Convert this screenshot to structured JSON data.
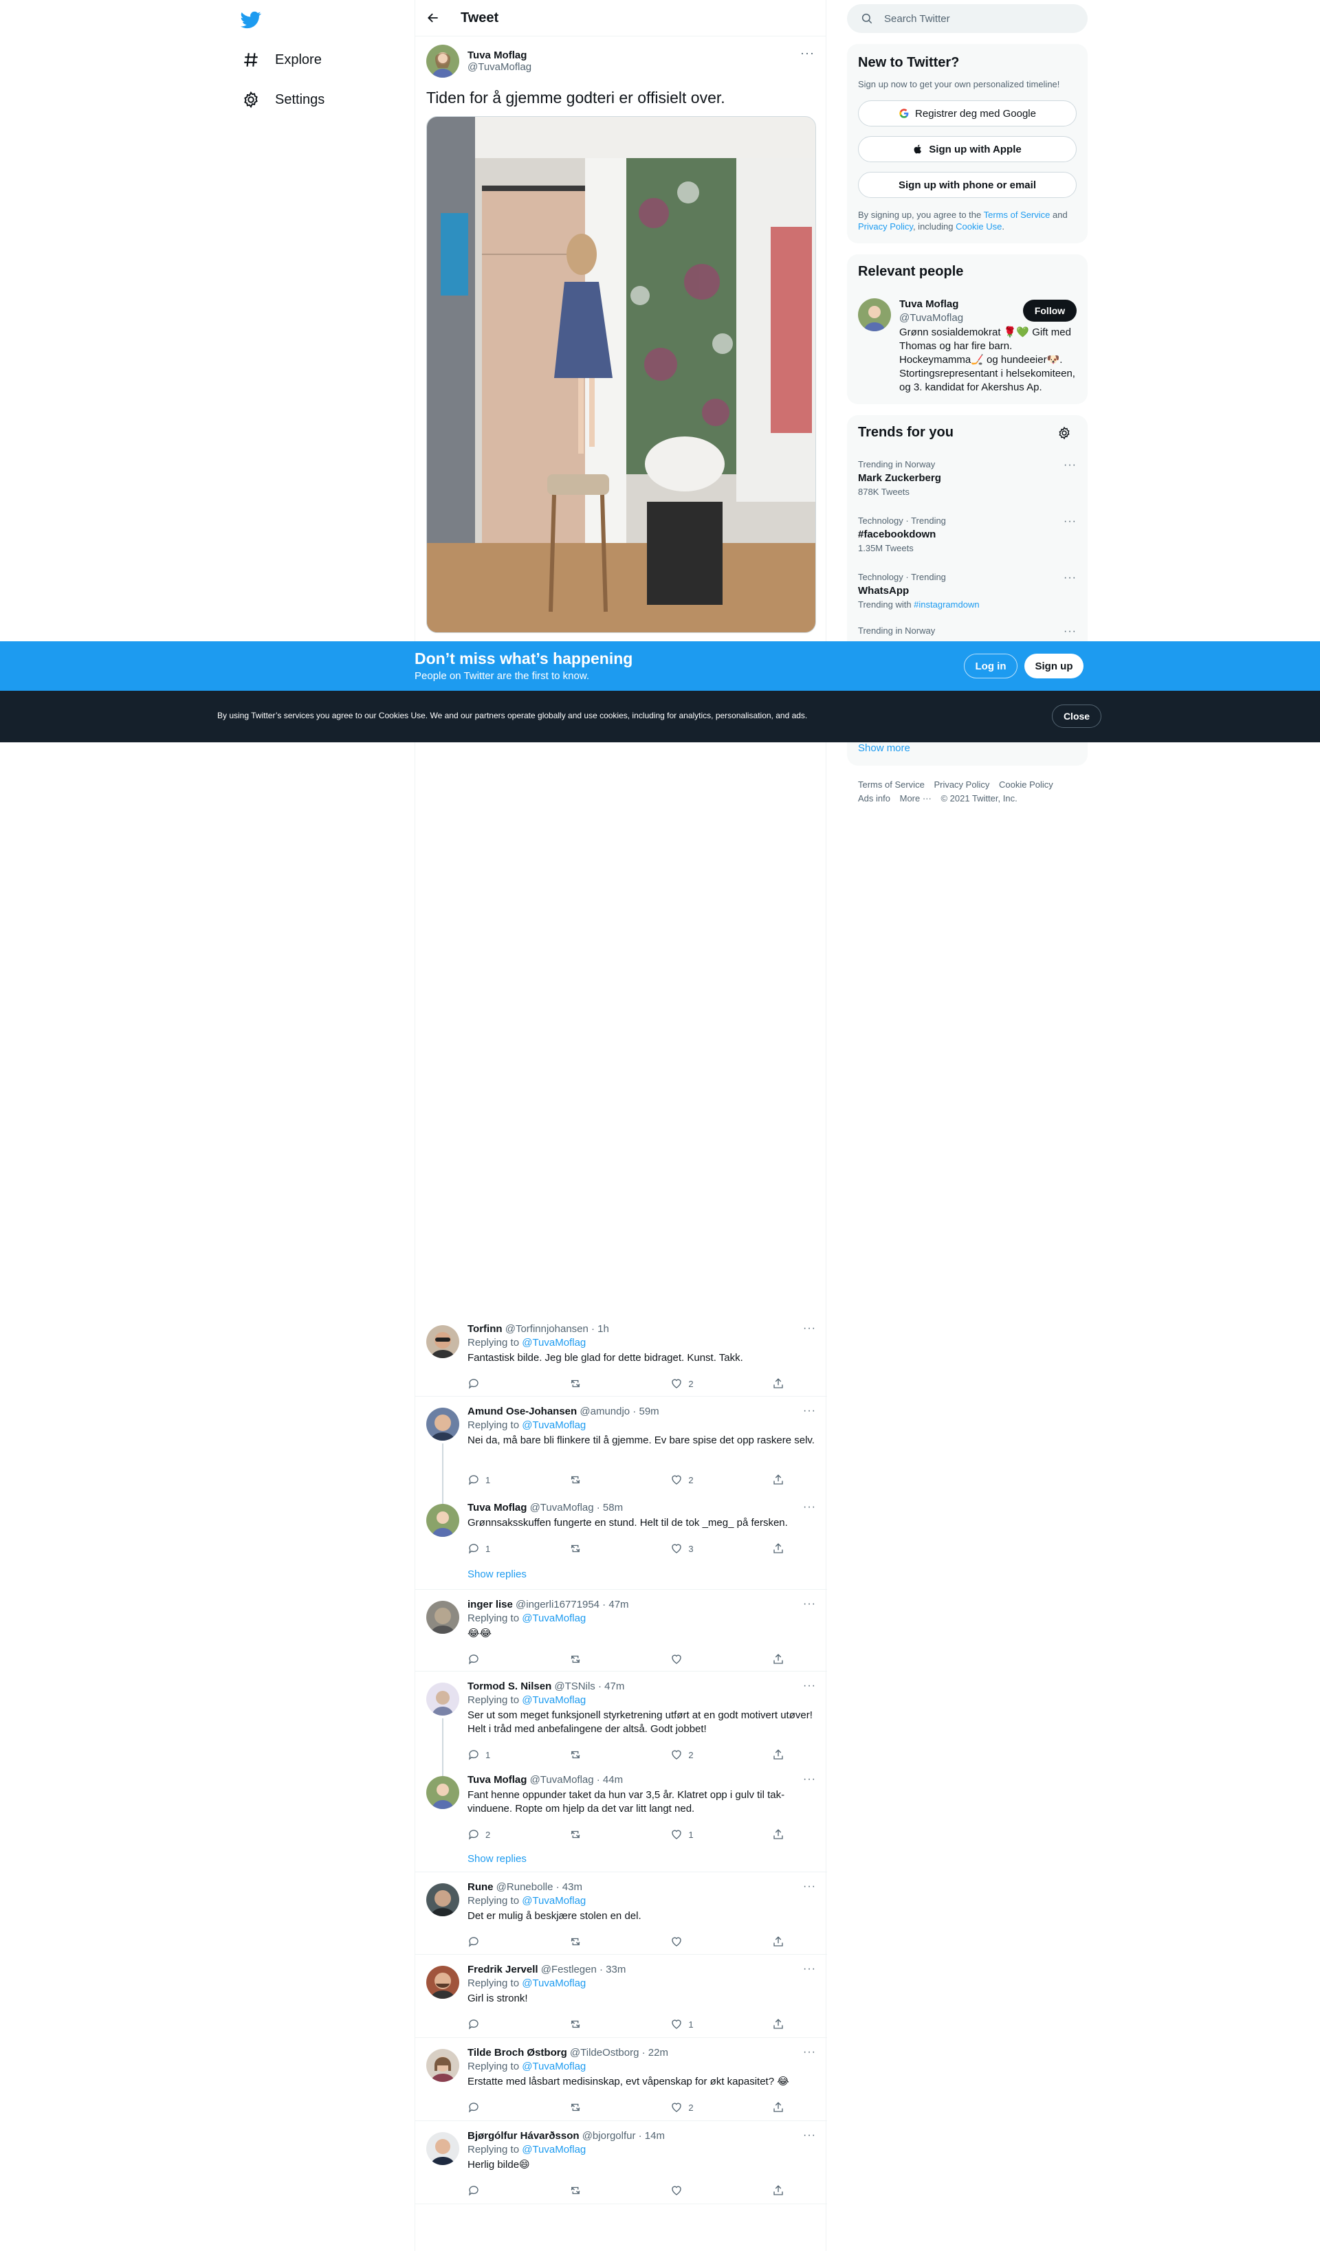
{
  "nav": {
    "explore": "Explore",
    "settings": "Settings"
  },
  "header": {
    "title": "Tweet"
  },
  "main_tweet": {
    "name": "Tuva Moflag",
    "handle": "@TuvaMoflag",
    "text": "Tiden for å gjemme godteri er offisielt over."
  },
  "banner": {
    "title": "Don’t miss what’s happening",
    "subtitle": "People on Twitter are the first to know.",
    "login": "Log in",
    "signup": "Sign up"
  },
  "cookie": {
    "text": "By using Twitter’s services you agree to our Cookies Use. We and our partners operate globally and use cookies, including for analytics, personalisation, and ads.",
    "close": "Close"
  },
  "search": {
    "placeholder": "Search Twitter"
  },
  "new_to_twitter": {
    "title": "New to Twitter?",
    "subtitle": "Sign up now to get your own personalized timeline!",
    "google": "Registrer deg med Google",
    "apple": "Sign up with Apple",
    "phone": "Sign up with phone or email",
    "legal_1": "By signing up, you agree to the ",
    "tos": "Terms of Service",
    "and": " and ",
    "privacy": "Privacy Policy",
    "including": ", including ",
    "cookie_use": "Cookie Use",
    "period": "."
  },
  "relevant": {
    "title": "Relevant people",
    "name": "Tuva Moflag",
    "handle": "@TuvaMoflag",
    "follow": "Follow",
    "bio": "Grønn sosialdemokrat 🌹💚 Gift med Thomas og har fire barn. Hockeymamma🏒 og hundeeier🐶. Stortingsrepresentant i helsekomiteen, og 3. kandidat for Akershus Ap."
  },
  "trends": {
    "title": "Trends for you",
    "items": [
      {
        "meta": "Trending in Norway",
        "name": "Mark Zuckerberg",
        "count": "878K Tweets"
      },
      {
        "meta": "Technology · Trending",
        "name": "#facebookdown",
        "count": "1.35M Tweets"
      },
      {
        "meta": "Technology · Trending",
        "name": "WhatsApp",
        "count_prefix": "Trending with ",
        "count_link": "#instagramdown"
      },
      {
        "meta": "Trending in Norway"
      }
    ],
    "show_more": "Show more"
  },
  "footer": {
    "tos": "Terms of Service",
    "privacy": "Privacy Policy",
    "cookie": "Cookie Policy",
    "ads": "Ads info",
    "more": "More ···",
    "copyright": "© 2021 Twitter, Inc."
  },
  "replying_to_label": "Replying to ",
  "show_replies": "Show replies",
  "replies": [
    {
      "name": "Torfinn",
      "handle": "@Torfinnjohansen · 1h",
      "replying": "@TuvaMoflag",
      "text": "Fantastisk bilde. Jeg ble glad for dette bidraget. Kunst. Takk.",
      "replies": "",
      "likes": "2"
    },
    {
      "name": "Amund Ose-Johansen",
      "handle": "@amundjo · 59m",
      "replying": "@TuvaMoflag",
      "text": "Nei da, må bare bli flinkere til å gjemme. Ev bare spise det opp raskere selv.",
      "replies": "1",
      "likes": "2"
    },
    {
      "name": "Tuva Moflag",
      "handle": "@TuvaMoflag · 58m",
      "replying": "",
      "text": "Grønnsaksskuffen fungerte en stund. Helt til de tok _meg_ på fersken.",
      "replies": "1",
      "likes": "3"
    },
    {
      "name": "inger lise",
      "handle": "@ingerli16771954 · 47m",
      "replying": "@TuvaMoflag",
      "text": "😂😂",
      "replies": "",
      "likes": ""
    },
    {
      "name": "Tormod S. Nilsen",
      "handle": "@TSNils · 47m",
      "replying": "@TuvaMoflag",
      "text": "Ser ut som meget funksjonell styrketrening utført at en godt motivert utøver! Helt i tråd med anbefalingene der altså. Godt jobbet!",
      "replies": "1",
      "likes": "2"
    },
    {
      "name": "Tuva Moflag",
      "handle": "@TuvaMoflag · 44m",
      "replying": "",
      "text": "Fant henne oppunder taket da hun var 3,5 år. Klatret opp i gulv til tak-vinduene. Ropte om hjelp da det var litt langt ned.",
      "replies": "2",
      "likes": "1"
    },
    {
      "name": "Rune",
      "handle": "@Runebolle · 43m",
      "replying": "@TuvaMoflag",
      "text": "Det er mulig å beskjære stolen en del.",
      "replies": "",
      "likes": ""
    },
    {
      "name": "Fredrik Jervell",
      "handle": "@Festlegen · 33m",
      "replying": "@TuvaMoflag",
      "text": "Girl is stronk!",
      "replies": "",
      "likes": "1"
    },
    {
      "name": "Tilde Broch Østborg",
      "handle": "@TildeOstborg · 22m",
      "replying": "@TuvaMoflag",
      "text": "Erstatte med låsbart medisinskap, evt våpenskap for økt kapasitet? 😂",
      "replies": "",
      "likes": "2"
    },
    {
      "name": "Bjørgólfur Hávarðsson",
      "handle": "@bjorgolfur · 14m",
      "replying": "@TuvaMoflag",
      "text": "Herlig bilde😄",
      "replies": "",
      "likes": ""
    }
  ],
  "colors": {
    "accent": "#1d9bf0",
    "dark": "#0f1419",
    "muted": "#536471",
    "cookie_bg": "#15202b"
  }
}
